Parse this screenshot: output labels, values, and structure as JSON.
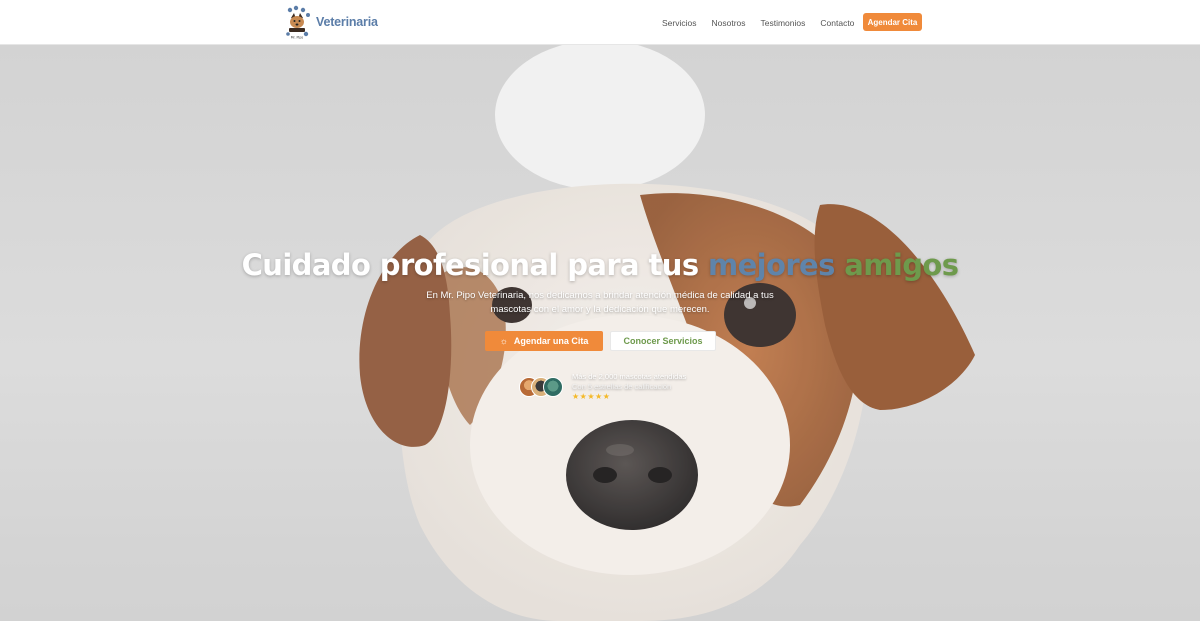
{
  "brand": {
    "logo_text": "Mr. Pipo",
    "name": "Veterinaria"
  },
  "nav": {
    "links": [
      "Servicios",
      "Nosotros",
      "Testimonios",
      "Contacto"
    ],
    "cta_label": "Agendar Cita"
  },
  "hero": {
    "title_main": "Cuidado profesional para tus ",
    "title_highlight_1": "mejores",
    "title_highlight_2": "amigos",
    "subtitle": "En Mr. Pipo Veterinaria, nos dedicamos a brindar atención médica de calidad a tus mascotas con el amor y la dedicación que merecen.",
    "primary_button": "Agendar una Cita",
    "secondary_button": "Conocer Servicios",
    "social_proof": {
      "line1": "Más de 2,000 mascotas atendidas",
      "line2": "Con 5 estrellas de calificación",
      "stars": "★★★★★",
      "rating": 5
    }
  },
  "colors": {
    "accent_orange": "#f08a3a",
    "accent_green": "#6e9a4c",
    "accent_blue": "#5f84aa"
  },
  "icons": {
    "primary_button_icon": "sun-icon"
  }
}
